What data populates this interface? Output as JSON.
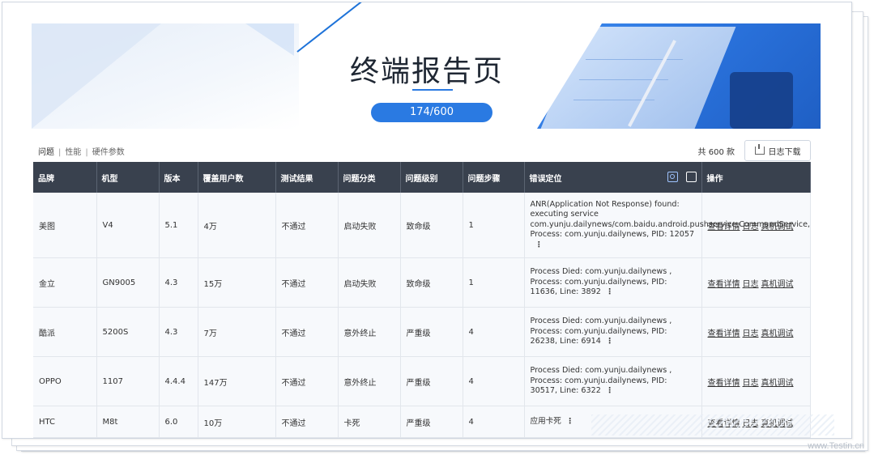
{
  "header": {
    "title": "终端报告页",
    "progress": "174/600"
  },
  "toolbar": {
    "tabs": [
      "问题",
      "性能",
      "硬件参数"
    ],
    "active_tab": "问题",
    "total": "共 600 款",
    "download_label": "日志下载"
  },
  "table": {
    "columns": [
      "品牌",
      "机型",
      "版本",
      "覆盖用户数",
      "测试结果",
      "问题分类",
      "问题级别",
      "问题步骤",
      "错误定位",
      "操作"
    ],
    "rows": [
      {
        "brand": "美图",
        "model": "V4",
        "version": "5.1",
        "users": "4万",
        "result": "不通过",
        "category": "启动失败",
        "level": "致命级",
        "step": "1",
        "error": "ANR(Application Not Response) found: executing service com.yunju.dailynews/com.baidu.android.pushservice.CommandService, Process: com.yunju.dailynews, PID: 12057"
      },
      {
        "brand": "金立",
        "model": "GN9005",
        "version": "4.3",
        "users": "15万",
        "result": "不通过",
        "category": "启动失败",
        "level": "致命级",
        "step": "1",
        "error": "Process Died: com.yunju.dailynews , Process: com.yunju.dailynews, PID: 11636, Line: 3892"
      },
      {
        "brand": "酷派",
        "model": "5200S",
        "version": "4.3",
        "users": "7万",
        "result": "不通过",
        "category": "意外终止",
        "level": "严重级",
        "step": "4",
        "error": "Process Died: com.yunju.dailynews , Process: com.yunju.dailynews, PID: 26238, Line: 6914"
      },
      {
        "brand": "OPPO",
        "model": "1107",
        "version": "4.4.4",
        "users": "147万",
        "result": "不通过",
        "category": "意外终止",
        "level": "严重级",
        "step": "4",
        "error": "Process Died: com.yunju.dailynews , Process: com.yunju.dailynews, PID: 30517, Line: 6322"
      },
      {
        "brand": "HTC",
        "model": "M8t",
        "version": "6.0",
        "users": "10万",
        "result": "不通过",
        "category": "卡死",
        "level": "严重级",
        "step": "4",
        "error": "应用卡死"
      }
    ],
    "actions": [
      "查看详情",
      "日志",
      "真机调试"
    ],
    "more_glyph": "⋮"
  },
  "watermark": "www.Testin.cn",
  "colors": {
    "accent": "#2a7ae2",
    "header_bg": "#39414e"
  }
}
